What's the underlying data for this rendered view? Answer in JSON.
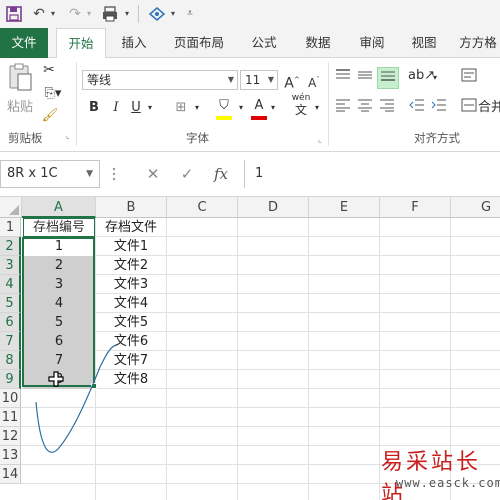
{
  "ribbon_tabs": [
    "文件",
    "开始",
    "插入",
    "页面布局",
    "公式",
    "数据",
    "审阅",
    "视图",
    "方方格"
  ],
  "clipboard": {
    "paste_label": "粘贴",
    "group_label": "剪贴板"
  },
  "font": {
    "name": "等线",
    "size": "11",
    "group_label": "字体",
    "grow": "A",
    "shrink": "A",
    "bold": "B",
    "italic": "I",
    "underline": "U",
    "font_color": "A",
    "pinyin": "wén",
    "pinyin_char": "文"
  },
  "alignment": {
    "group_label": "对齐方式",
    "merge_label": "合并"
  },
  "name_box": "8R x 1C",
  "formula_value": "1",
  "fx": "fx",
  "columns": [
    "A",
    "B",
    "C",
    "D",
    "E",
    "F",
    "G"
  ],
  "rows": [
    "1",
    "2",
    "3",
    "4",
    "5",
    "6",
    "7",
    "8",
    "9",
    "10",
    "11",
    "12",
    "13",
    "14"
  ],
  "header_row": {
    "A": "存档编号",
    "B": "存档文件"
  },
  "data_rows": [
    {
      "A": "1",
      "B": "文件1"
    },
    {
      "A": "2",
      "B": "文件2"
    },
    {
      "A": "3",
      "B": "文件3"
    },
    {
      "A": "4",
      "B": "文件4"
    },
    {
      "A": "5",
      "B": "文件5"
    },
    {
      "A": "6",
      "B": "文件6"
    },
    {
      "A": "7",
      "B": "文件7"
    },
    {
      "A": "8",
      "B": "文件8"
    }
  ],
  "accent": "#217346",
  "watermark": {
    "text": "易采站长站",
    "url": "www.easck.com"
  }
}
